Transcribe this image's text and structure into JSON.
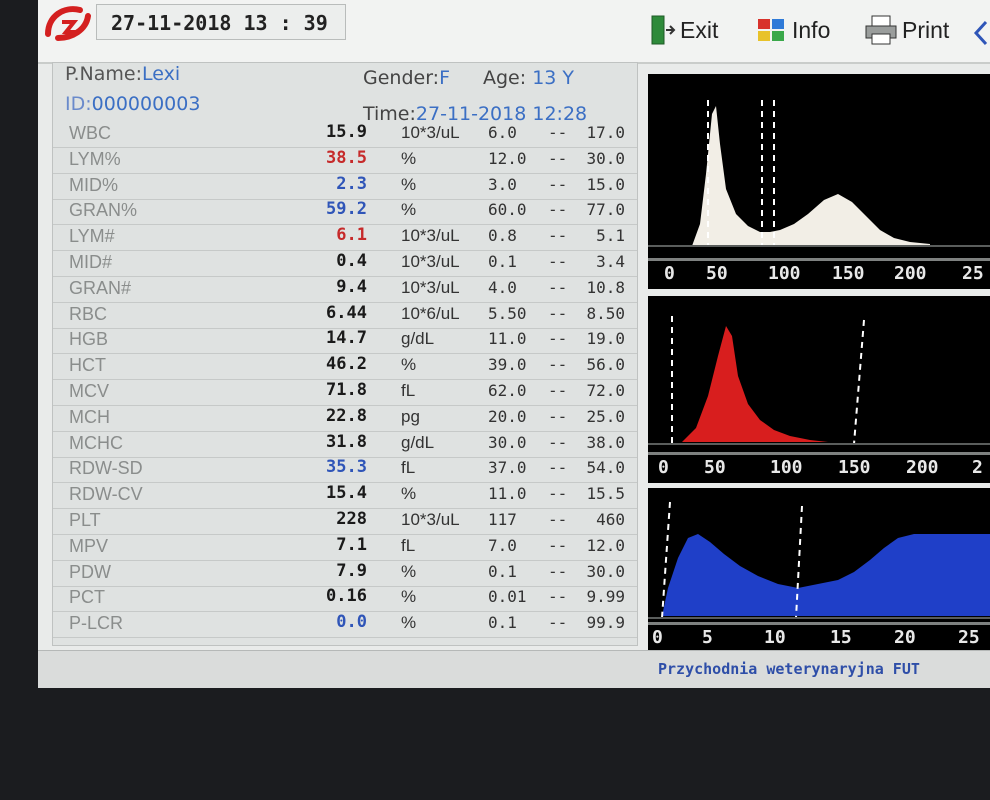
{
  "header": {
    "datetime": "27-11-2018  13 : 39",
    "exit_label": "Exit",
    "info_label": "Info",
    "print_label": "Print"
  },
  "patient": {
    "name_label": "P.Name:",
    "name_value": "Lexi",
    "id_label": "ID:",
    "id_value": "000000003",
    "gender_label": "Gender:",
    "gender_value": "F",
    "age_label": "Age:",
    "age_value": "13 Y",
    "time_label": "Time:",
    "time_value": "27-11-2018 12:28"
  },
  "results": [
    {
      "name": "WBC",
      "value": "15.9",
      "unit": "10*3/uL",
      "low": "6.0",
      "high": "17.0",
      "color": "#1a1a1a"
    },
    {
      "name": "LYM%",
      "value": "38.5",
      "unit": "%",
      "low": "12.0",
      "high": "30.0",
      "color": "#c62a2a"
    },
    {
      "name": "MID%",
      "value": "2.3",
      "unit": "%",
      "low": "3.0",
      "high": "15.0",
      "color": "#2f55b8"
    },
    {
      "name": "GRAN%",
      "value": "59.2",
      "unit": "%",
      "low": "60.0",
      "high": "77.0",
      "color": "#2f55b8"
    },
    {
      "name": "LYM#",
      "value": "6.1",
      "unit": "10*3/uL",
      "low": "0.8",
      "high": "5.1",
      "color": "#c62a2a"
    },
    {
      "name": "MID#",
      "value": "0.4",
      "unit": "10*3/uL",
      "low": "0.1",
      "high": "3.4",
      "color": "#1a1a1a"
    },
    {
      "name": "GRAN#",
      "value": "9.4",
      "unit": "10*3/uL",
      "low": "4.0",
      "high": "10.8",
      "color": "#1a1a1a"
    },
    {
      "name": "RBC",
      "value": "6.44",
      "unit": "10*6/uL",
      "low": "5.50",
      "high": "8.50",
      "color": "#1a1a1a"
    },
    {
      "name": "HGB",
      "value": "14.7",
      "unit": "g/dL",
      "low": "11.0",
      "high": "19.0",
      "color": "#1a1a1a"
    },
    {
      "name": "HCT",
      "value": "46.2",
      "unit": "%",
      "low": "39.0",
      "high": "56.0",
      "color": "#1a1a1a"
    },
    {
      "name": "MCV",
      "value": "71.8",
      "unit": "fL",
      "low": "62.0",
      "high": "72.0",
      "color": "#1a1a1a"
    },
    {
      "name": "MCH",
      "value": "22.8",
      "unit": "pg",
      "low": "20.0",
      "high": "25.0",
      "color": "#1a1a1a"
    },
    {
      "name": "MCHC",
      "value": "31.8",
      "unit": "g/dL",
      "low": "30.0",
      "high": "38.0",
      "color": "#1a1a1a"
    },
    {
      "name": "RDW-SD",
      "value": "35.3",
      "unit": "fL",
      "low": "37.0",
      "high": "54.0",
      "color": "#2f55b8"
    },
    {
      "name": "RDW-CV",
      "value": "15.4",
      "unit": "%",
      "low": "11.0",
      "high": "15.5",
      "color": "#1a1a1a"
    },
    {
      "name": "PLT",
      "value": "228",
      "unit": "10*3/uL",
      "low": "117",
      "high": "460",
      "color": "#1a1a1a"
    },
    {
      "name": "MPV",
      "value": "7.1",
      "unit": "fL",
      "low": "7.0",
      "high": "12.0",
      "color": "#1a1a1a"
    },
    {
      "name": "PDW",
      "value": "7.9",
      "unit": "%",
      "low": "0.1",
      "high": "30.0",
      "color": "#1a1a1a"
    },
    {
      "name": "PCT",
      "value": "0.16",
      "unit": "%",
      "low": "0.01",
      "high": "9.99",
      "color": "#1a1a1a"
    },
    {
      "name": "P-LCR",
      "value": "0.0",
      "unit": "%",
      "low": "0.1",
      "high": "99.9",
      "color": "#2f55b8"
    }
  ],
  "range_separator": "--",
  "histograms": {
    "wbc": {
      "ticks": [
        "0",
        "50",
        "100",
        "150",
        "200",
        "25"
      ],
      "color": "#f2eee6"
    },
    "rbc": {
      "ticks": [
        "0",
        "50",
        "100",
        "150",
        "200",
        "2"
      ],
      "color": "#d81e1e"
    },
    "plt": {
      "ticks": [
        "0",
        "5",
        "10",
        "15",
        "20",
        "25"
      ],
      "color": "#1f3fc8"
    }
  },
  "footer": {
    "text": "Przychodnia weterynaryjna FUT"
  }
}
